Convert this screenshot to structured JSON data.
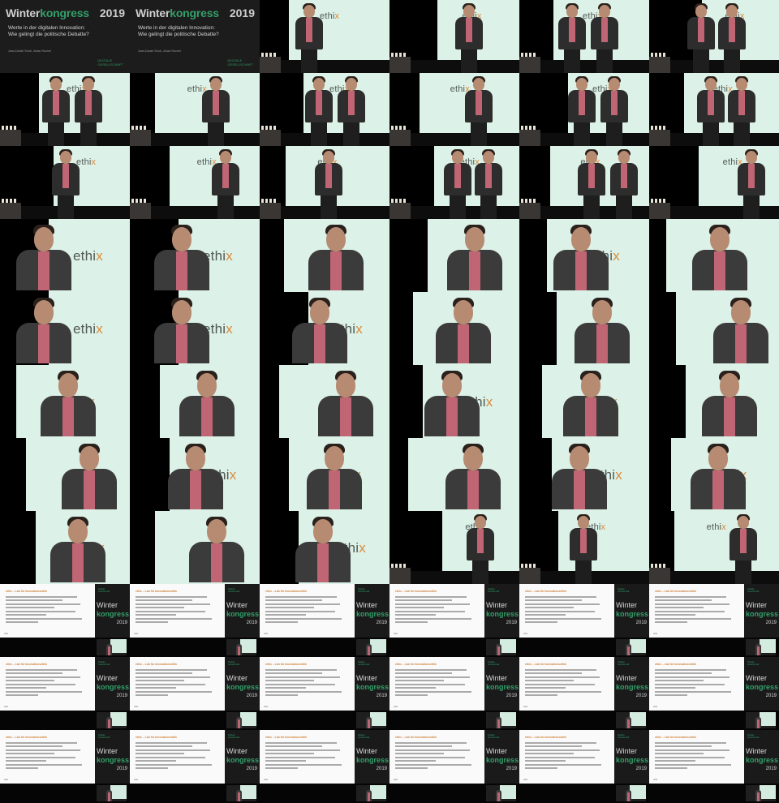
{
  "title_slide": {
    "brand_winter": "Winter",
    "brand_kongress": "kongress",
    "year": "2019",
    "title_line1": "Werte in der digitalen Innovation:",
    "title_line2": "Wie gelingt die politische Debatte?",
    "authors": "Jean-Daniel Strub, Johan Rochel",
    "logo_line1": "Digitale",
    "logo_line2": "Gesellschaft"
  },
  "screen_word": {
    "prefix": "ethi",
    "accent": "x"
  },
  "stream_slide": {
    "heading": "ethix – Lab für Innovationsethik",
    "footer": "ethix"
  },
  "stream_side": {
    "org1": "Digitale",
    "org2": "Gesellschaft",
    "w1": "Winter",
    "w2": "kongress",
    "year": "2019"
  },
  "colors": {
    "accent_green": "#33a06a",
    "accent_orange": "#dd8a3a",
    "screen": "#dcf1e7",
    "shirt": "#c06573"
  },
  "cells": [
    {
      "k": "title"
    },
    {
      "k": "title"
    },
    {
      "k": "wide",
      "p": 1
    },
    {
      "k": "wide",
      "p": 1
    },
    {
      "k": "wide",
      "p": 2
    },
    {
      "k": "wide",
      "p": 2
    },
    {
      "k": "wide",
      "p": 2
    },
    {
      "k": "wide",
      "p": 1
    },
    {
      "k": "wide",
      "p": 2
    },
    {
      "k": "wide",
      "p": 1
    },
    {
      "k": "wide",
      "p": 2
    },
    {
      "k": "wide",
      "p": 2
    },
    {
      "k": "wide",
      "p": 1
    },
    {
      "k": "wide",
      "p": 1
    },
    {
      "k": "wide",
      "p": 1
    },
    {
      "k": "wide",
      "p": 2
    },
    {
      "k": "wide",
      "p": 2
    },
    {
      "k": "wide",
      "p": 1
    },
    {
      "k": "close",
      "s": "L"
    },
    {
      "k": "close",
      "s": "L"
    },
    {
      "k": "close",
      "s": "R"
    },
    {
      "k": "close",
      "s": "R"
    },
    {
      "k": "close",
      "s": "R"
    },
    {
      "k": "close",
      "s": "R"
    },
    {
      "k": "close",
      "s": "L"
    },
    {
      "k": "close",
      "s": "L"
    },
    {
      "k": "close",
      "s": "L"
    },
    {
      "k": "close",
      "s": "R"
    },
    {
      "k": "close",
      "s": "R"
    },
    {
      "k": "close",
      "s": "R"
    },
    {
      "k": "close",
      "s": "R"
    },
    {
      "k": "close",
      "s": "R"
    },
    {
      "k": "close",
      "s": "R"
    },
    {
      "k": "close",
      "s": "R"
    },
    {
      "k": "close",
      "s": "R"
    },
    {
      "k": "close",
      "s": "R"
    },
    {
      "k": "close",
      "s": "R"
    },
    {
      "k": "close",
      "s": "R"
    },
    {
      "k": "close",
      "s": "R"
    },
    {
      "k": "close",
      "s": "R"
    },
    {
      "k": "close",
      "s": "R"
    },
    {
      "k": "close",
      "s": "R"
    },
    {
      "k": "close",
      "s": "R"
    },
    {
      "k": "close",
      "s": "R"
    },
    {
      "k": "close",
      "s": "R"
    },
    {
      "k": "wide",
      "p": 1
    },
    {
      "k": "wide",
      "p": 1
    },
    {
      "k": "wide",
      "p": 1
    },
    {
      "k": "stream"
    },
    {
      "k": "stream"
    },
    {
      "k": "stream"
    },
    {
      "k": "stream"
    },
    {
      "k": "stream"
    },
    {
      "k": "stream"
    },
    {
      "k": "stream"
    },
    {
      "k": "stream"
    },
    {
      "k": "stream"
    },
    {
      "k": "stream"
    },
    {
      "k": "stream"
    },
    {
      "k": "stream"
    },
    {
      "k": "stream"
    },
    {
      "k": "stream"
    },
    {
      "k": "stream"
    },
    {
      "k": "stream"
    },
    {
      "k": "stream"
    },
    {
      "k": "stream"
    }
  ]
}
